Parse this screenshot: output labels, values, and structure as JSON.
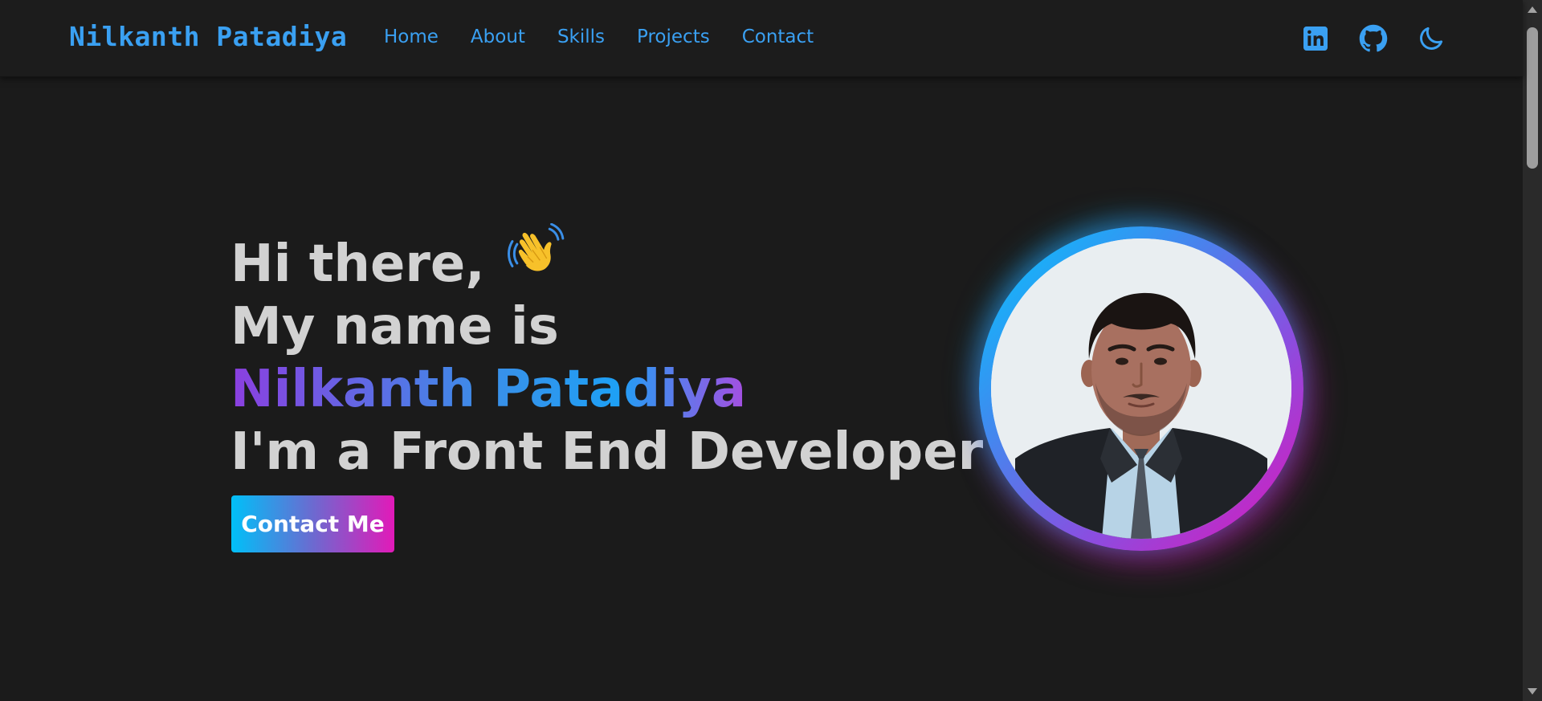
{
  "navbar": {
    "brand": "Nilkanth Patadiya",
    "links": [
      "Home",
      "About",
      "Skills",
      "Projects",
      "Contact"
    ],
    "icons": [
      "linkedin-icon",
      "github-icon",
      "moon-icon"
    ]
  },
  "hero": {
    "greeting": "Hi there,",
    "intro": "My name is",
    "name": "Nilkanth Patadiya",
    "role": "I'm a Front End Developer",
    "wave_icon": "waving-hand-icon",
    "contact_button": "Contact Me"
  },
  "colors": {
    "background": "#1b1b1b",
    "navbar": "#1c1c1c",
    "accent_blue": "#3aa0f2",
    "gradient_start": "#00c0f8",
    "gradient_end": "#e21ab8",
    "heading_text": "#d2d2d2"
  }
}
